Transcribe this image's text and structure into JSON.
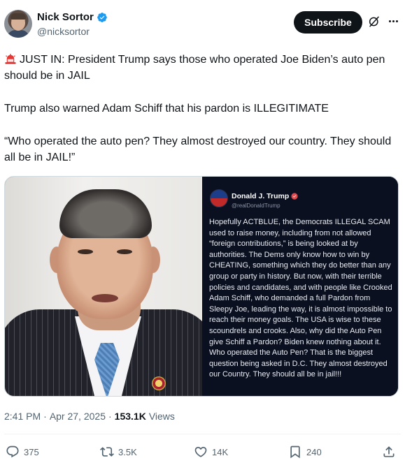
{
  "author": {
    "name": "Nick Sortor",
    "handle": "@nicksortor",
    "verified_color": "#1d9bf0"
  },
  "header": {
    "subscribe_label": "Subscribe",
    "grok_icon": "grok-icon",
    "more_icon": "more-horizontal-icon"
  },
  "tweet": {
    "paragraphs": [
      "JUST IN: President Trump says those who operated Joe Biden’s auto pen should be in JAIL",
      "Trump also warned Adam Schiff that his pardon is ILLEGITIMATE",
      "“Who operated the auto pen? They almost destroyed our country. They should all be in JAIL!”"
    ],
    "lead_icon": "police-siren-icon"
  },
  "media": {
    "truth_post": {
      "name": "Donald J. Trump",
      "handle": "@realDonaldTrump",
      "text": "Hopefully ACTBLUE, the Democrats ILLEGAL SCAM used to raise money, including from not allowed “foreign contributions,” is being looked at by authorities. The Dems only know how to win by CHEATING, something which they do better than any group or party in history. But now, with their terrible policies and candidates, and with people like Crooked Adam Schiff, who demanded a full Pardon from Sleepy Joe, leading the way, it is almost impossible to reach their money goals. The USA is wise to these scoundrels and crooks. Also, why did the Auto Pen give Schiff a Pardon? Biden knew nothing about it. Who operated the Auto Pen? That is the biggest question being asked in D.C. They almost destroyed our Country. They should all be in jail!!!"
    }
  },
  "meta": {
    "time": "2:41 PM",
    "separator": "·",
    "date": "Apr 27, 2025",
    "views_count": "153.1K",
    "views_label": "Views"
  },
  "actions": {
    "replies": "375",
    "reposts": "3.5K",
    "likes": "14K",
    "bookmarks": "240"
  },
  "colors": {
    "text_primary": "#0f1419",
    "text_secondary": "#536471",
    "accent": "#1d9bf0",
    "card_bg": "#0b1020"
  }
}
